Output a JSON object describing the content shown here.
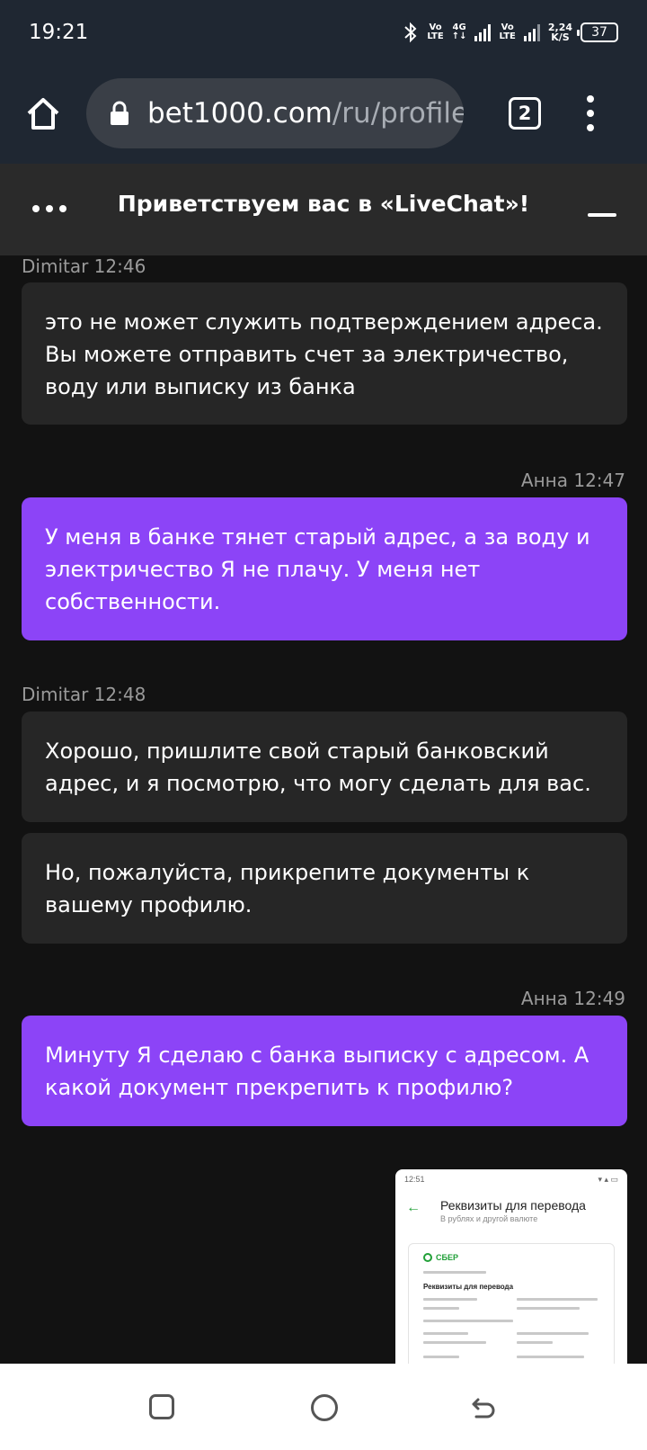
{
  "status_bar": {
    "time": "19:21",
    "network_1": [
      "Vo",
      "LTE"
    ],
    "network_type": "4G",
    "network_2": [
      "Vo",
      "LTE"
    ],
    "speed": [
      "2,24",
      "K/S"
    ],
    "battery": "37"
  },
  "browser": {
    "url_domain": "bet1000.com",
    "url_path": "/ru/profile/",
    "tab_count": "2"
  },
  "chat": {
    "title": "Приветствуем вас в «LiveChat»!",
    "messages": [
      {
        "sender": "Dimitar 12:46",
        "text": "это не может служить подтверждением адреса. Вы можете отправить счет за электричество, воду или выписку из банка"
      },
      {
        "sender": "Анна 12:47",
        "text": "У меня в банке тянет старый адрес, а за воду и электричество Я не плачу. У меня нет собственности."
      },
      {
        "sender": "Dimitar 12:48",
        "text": "Хорошо, пришлите свой старый банковский адрес, и я посмотрю, что могу сделать для вас."
      },
      {
        "text": "Но, пожалуйста, прикрепите документы к вашему профилю."
      },
      {
        "sender": "Анна 12:49",
        "text": "Минуту Я сделаю с банка выписку с адресом. А какой документ прекрепить к профилю?"
      }
    ],
    "attachment": {
      "status_time": "12:51",
      "title": "Реквизиты для перевода",
      "subtitle": "В рублях и другой валюте",
      "logo": "СБЕР",
      "heading": "Реквизиты для перевода"
    }
  },
  "colors": {
    "status_bg": "#1f2732",
    "chat_header_bg": "#2a2a2a",
    "agent_bubble": "#262626",
    "user_bubble": "#8c44f7",
    "page_bg": "#121212"
  }
}
